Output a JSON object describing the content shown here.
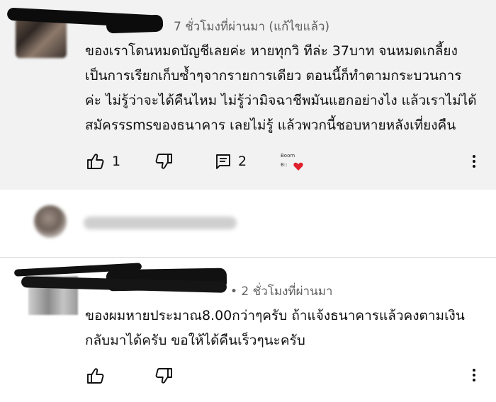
{
  "comments": [
    {
      "meta": "7 ชั่วโมงที่ผ่านมา (แก้ไขแล้ว)",
      "lines": [
        "ของเราโดนหมดบัญชีเลยค่ะ หายทุกวิ ทีล่ะ 37บาท จนหมดเกลี้ยง",
        "เป็นการเรียกเก็บซ้ำๆจากรายการเดียว ตอนนี้ก็ทำตามกระบวนการ",
        "ค่ะ ไม่รู้ว่าจะได้คืนไหม ไม่รู้ว่ามิจฉาชีพมันแฮกอย่างไง แล้วเราไม่ได้",
        "สมัครรsmsของธนาคาร เลยไม่รู้ แล้วพวกนี้ชอบหายหลังเที่ยงคืน"
      ],
      "like_count": "1",
      "reply_count": "2",
      "boom_line1": "Boom",
      "boom_line2": "B::"
    },
    {
      "meta": "• 2 ชั่วโมงที่ผ่านมา",
      "lines": [
        "ของผมหายประมาณ8.00กว่าๆครับ ถ้าแจ้งธนาคารแล้วคงตามเงิน",
        "กลับมาได้ครับ ขอให้ได้คืนเร็วๆนะครับ"
      ]
    }
  ],
  "colors": {
    "highlight_bg": "#f2f2f2",
    "heart": "#e0202c"
  },
  "icons": [
    "thumb-up-icon",
    "thumb-down-icon",
    "comment-icon",
    "more-vert-icon",
    "heart-icon"
  ]
}
